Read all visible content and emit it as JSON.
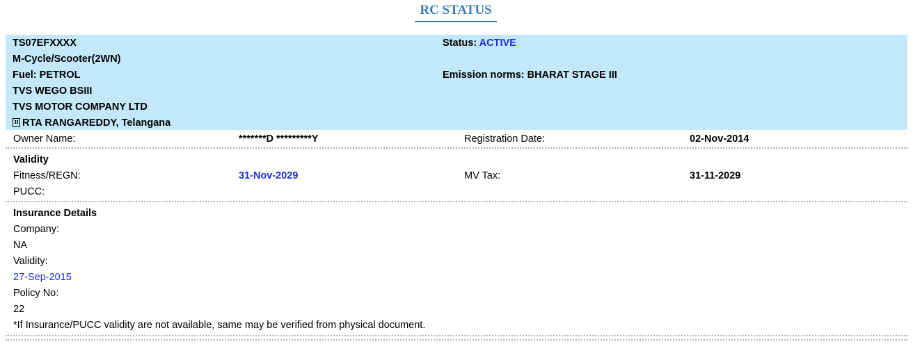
{
  "title": "RC STATUS",
  "vehicle": {
    "reg_no": "TS07EFXXXX",
    "status_label": "Status: ",
    "status_value": "ACTIVE",
    "class": "M-Cycle/Scooter(2WN)",
    "fuel": "Fuel: PETROL",
    "emission": "Emission norms: BHARAT STAGE III",
    "model": "TVS WEGO BSIII",
    "maker": "TVS MOTOR COMPANY LTD",
    "location_icon": "building-icon",
    "rta": "RTA RANGAREDDY, Telangana"
  },
  "owner": {
    "owner_label": "Owner Name:",
    "owner_value": "*******D *********Y",
    "reg_date_label": "Registration Date:",
    "reg_date_value": "02-Nov-2014"
  },
  "validity": {
    "heading": "Validity",
    "fitness_label": "Fitness/REGN:",
    "fitness_value": "31-Nov-2029",
    "mvtax_label": "MV Tax:",
    "mvtax_value": "31-11-2029",
    "pucc_label": "PUCC:"
  },
  "insurance": {
    "heading": "Insurance Details",
    "company_label": "Company:",
    "company_value": "NA",
    "validity_label": "Validity:",
    "validity_value": "27-Sep-2015",
    "policy_label": "Policy No:",
    "policy_value": "22",
    "note": "*If Insurance/PUCC validity are not available, same may be verified from physical document."
  },
  "colors": {
    "title": "#3a7fb5",
    "header_bg": "#c3e8fa",
    "accent_blue": "#1a2fd6"
  }
}
